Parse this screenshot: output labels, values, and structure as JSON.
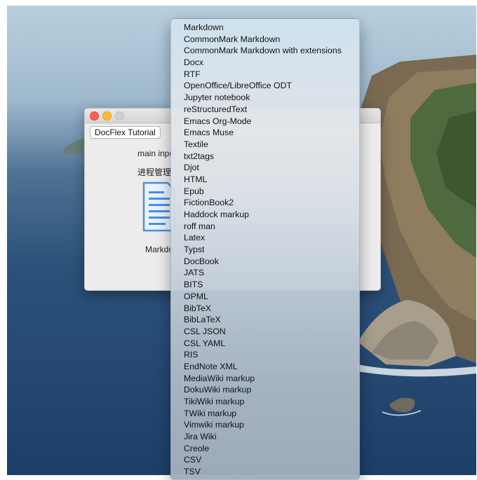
{
  "window": {
    "tutorial_button": "DocFlex Tutorial",
    "main_input_label": "main inpu",
    "process_label": "进程管理",
    "format_label": "Markdo"
  },
  "menu": {
    "items": [
      "Markdown",
      "CommonMark Markdown",
      "CommonMark Markdown with extensions",
      "Docx",
      "RTF",
      "OpenOffice/LibreOffice ODT",
      "Jupyter notebook",
      "reStructuredText",
      "Emacs Org-Mode",
      "Emacs Muse",
      "Textile",
      "txt2tags",
      "Djot",
      "HTML",
      "Epub",
      "FictionBook2",
      "Haddock markup",
      "roff man",
      "Latex",
      "Typst",
      "DocBook",
      "JATS",
      "BITS",
      "OPML",
      "BibTeX",
      "BibLaTeX",
      "CSL JSON",
      "CSL YAML",
      "RIS",
      "EndNote XML",
      "MediaWiki markup",
      "DokuWiki markup",
      "TikiWiki markup",
      "TWiki markup",
      "Vimwiki markup",
      "Jira Wiki",
      "Creole",
      "CSV",
      "TSV"
    ]
  },
  "colors": {
    "close": "#ff5f57",
    "minimize": "#febc2e",
    "zoom_disabled": "#d0d0d0",
    "doc_icon": "#4a8fe0"
  },
  "icons": {
    "document": "document-icon"
  }
}
